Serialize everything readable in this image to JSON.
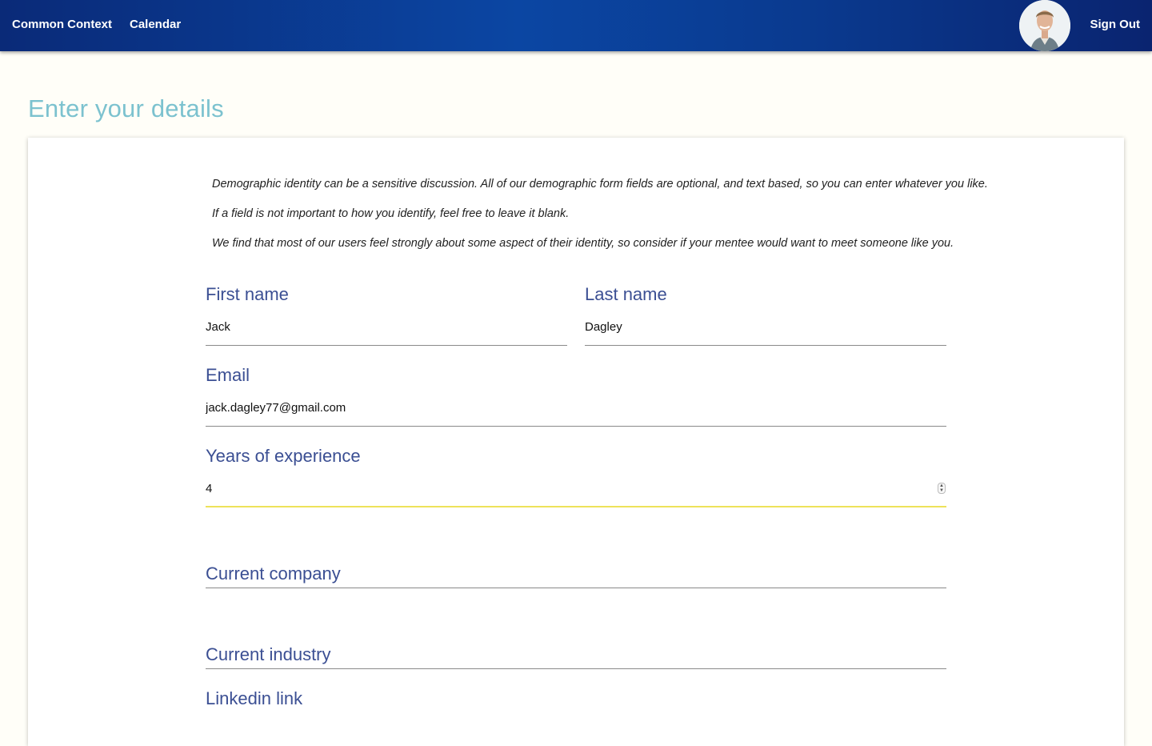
{
  "nav": {
    "brand": "Common Context",
    "calendar": "Calendar",
    "sign_out": "Sign Out"
  },
  "page": {
    "title": "Enter your details"
  },
  "intro": {
    "line1": "Demographic identity can be a sensitive discussion. All of our demographic form fields are optional, and text based, so you can enter whatever you like.",
    "line2": "If a field is not important to how you identify, feel free to leave it blank.",
    "line3": "We find that most of our users feel strongly about some aspect of their identity, so consider if your mentee would want to meet someone like you."
  },
  "form": {
    "first_name": {
      "label": "First name",
      "value": "Jack"
    },
    "last_name": {
      "label": "Last name",
      "value": "Dagley"
    },
    "email": {
      "label": "Email",
      "value": "jack.dagley77@gmail.com"
    },
    "years_experience": {
      "label": "Years of experience",
      "value": "4"
    },
    "current_company": {
      "label": "Current company",
      "value": ""
    },
    "current_industry": {
      "label": "Current industry",
      "value": ""
    },
    "linkedin": {
      "label": "Linkedin link",
      "value": ""
    }
  },
  "colors": {
    "nav_dark": "#0a2a78",
    "nav_light": "#0b46a3",
    "title": "#7cc2cf",
    "label": "#3b4f93",
    "focus_underline": "#ede25a",
    "background": "#fffef8"
  },
  "icons": {
    "avatar": "user-avatar-photo",
    "spinner": "number-spinner-icon"
  }
}
